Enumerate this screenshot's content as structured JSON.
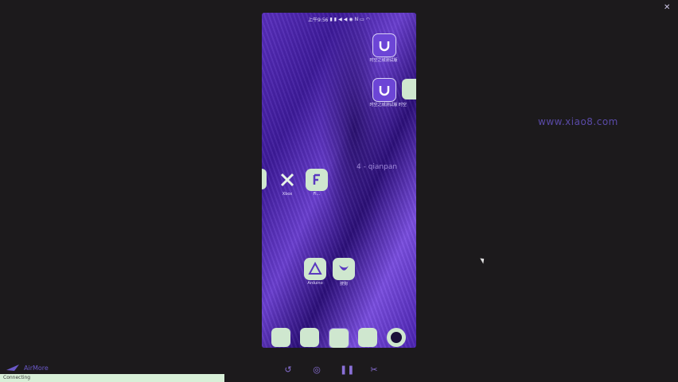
{
  "status_bar": {
    "time_text": "上午9:56",
    "icons": [
      "signal-icon",
      "signal-icon",
      "nav-icon",
      "nav-icon",
      "wechat-icon",
      "n-icon",
      "battery-icon",
      "wifi-icon"
    ]
  },
  "apps": [
    {
      "id": "app-top-right",
      "label": "时空之城测试版",
      "icon": "u-logo-icon"
    },
    {
      "id": "app-middle-right",
      "label": "时空之城测试版",
      "icon": "u-logo-icon"
    },
    {
      "id": "app-partial-right",
      "label": "时空",
      "icon": "blank-icon"
    },
    {
      "id": "app-x",
      "label": "Xbox",
      "icon": "x-logo-icon"
    },
    {
      "id": "app-f",
      "label": "Fi...",
      "icon": "f-logo-icon"
    },
    {
      "id": "app-triangle",
      "label": "Arduino",
      "icon": "triangle-logo-icon"
    },
    {
      "id": "app-bird",
      "label": "搜狗",
      "icon": "bird-logo-icon"
    }
  ],
  "widget_text": "4 - qianpan",
  "watermark": "www.xiao8.com",
  "dock": [
    {
      "icon": "phone-icon"
    },
    {
      "icon": "message-icon"
    },
    {
      "icon": "browser-icon"
    },
    {
      "icon": "gallery-icon"
    },
    {
      "icon": "camera-icon"
    }
  ],
  "bottom_brand": "AirMore",
  "status_strip_text": "Connecting",
  "colors": {
    "background": "#1c1a1c",
    "accent": "#6c45d6",
    "dock_icon": "#cfe7cf"
  }
}
